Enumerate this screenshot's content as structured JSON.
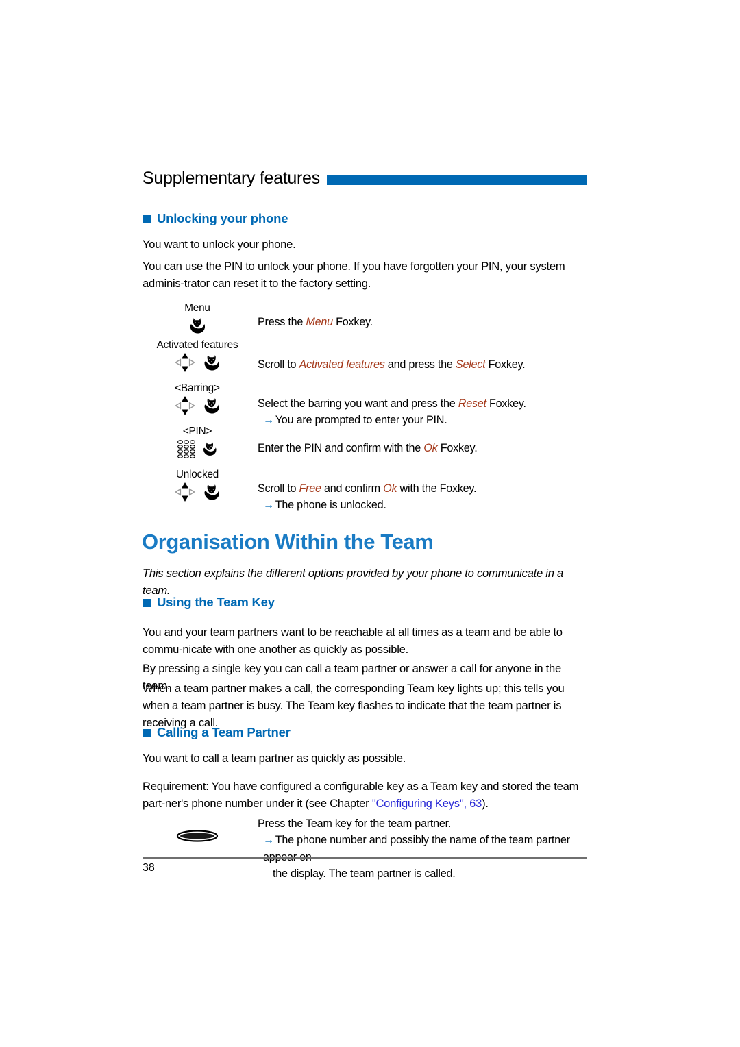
{
  "page": {
    "running_head": "Supplementary features",
    "page_number": "38",
    "accent_color": "#0069b4",
    "heading_color": "#1a7bc4",
    "highlight_color": "#a53a1c",
    "link_color": "#2a2ad6"
  },
  "section_unlocking": {
    "heading": "Unlocking your phone",
    "intro": "You want to unlock your phone.",
    "body": "You can use the PIN to unlock your phone. If you have forgotten your PIN, your system adminis-trator can reset it to the factory setting.",
    "steps": [
      {
        "label": "Menu",
        "icons": [
          "fox-key-icon"
        ],
        "text_pre": "Press the ",
        "highlight": "Menu",
        "text_post": " Foxkey.",
        "result": ""
      },
      {
        "label": "Activated features",
        "icons": [
          "navigation-cluster-icon",
          "fox-key-icon"
        ],
        "text_pre": "Scroll to ",
        "highlight": "Activated features",
        "text_mid": " and press the ",
        "highlight2": "Select",
        "text_post": " Foxkey.",
        "result": ""
      },
      {
        "label": "<Barring>",
        "icons": [
          "navigation-cluster-icon",
          "fox-key-icon"
        ],
        "text_pre": "Select the barring you want and press the ",
        "highlight": "Reset",
        "text_post": " Foxkey.",
        "result": "You are prompted to enter your PIN."
      },
      {
        "label": "<PIN>",
        "icons": [
          "keypad-icon",
          "fox-key-icon"
        ],
        "text_pre": "Enter the PIN and confirm with the  ",
        "highlight": "Ok",
        "text_post": "  Foxkey.",
        "result": ""
      },
      {
        "label": "Unlocked",
        "icons": [
          "navigation-cluster-icon",
          "fox-key-icon"
        ],
        "text_pre": "Scroll to ",
        "highlight": "Free",
        "text_mid": " and confirm ",
        "highlight2": "Ok",
        "text_post": " with the Foxkey.",
        "result": "The phone is unlocked."
      }
    ]
  },
  "chapter": {
    "title": "Organisation Within the Team",
    "intro": "This section explains the different options provided by your phone to communicate in a team."
  },
  "section_team_key": {
    "heading": "Using the Team Key",
    "paragraphs": [
      "You and your team partners want to be reachable at all times as a team and be able to commu-nicate with one another as quickly as possible.",
      "By pressing a single key you can call a team partner or answer a call for anyone in the team.",
      "When a team partner makes a call, the corresponding Team key lights up; this tells you when a team partner is busy. The Team key flashes to indicate that the team partner is receiving a call."
    ]
  },
  "section_calling": {
    "heading": "Calling a Team Partner",
    "intro": "You want to call a team partner as quickly as possible.",
    "requirement_pre": "Requirement: You have configured a configurable key as a Team key and stored the team part-ner's phone number under it (see Chapter ",
    "requirement_link": "\"Configuring Keys\", 63",
    "requirement_post": ").",
    "step": {
      "icons": [
        "team-key-oval-icon"
      ],
      "text": "Press the Team key for the team partner.",
      "result_line1": "The phone number and possibly the name of the team partner appear on",
      "result_line2": "the display. The team partner is called."
    }
  }
}
